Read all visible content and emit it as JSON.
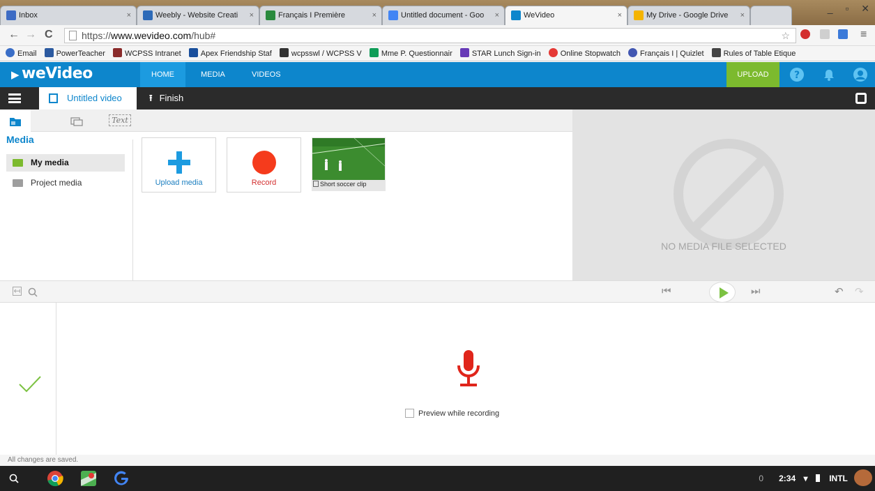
{
  "browser": {
    "tabs": [
      {
        "title": "Inbox",
        "icon": "mail-icon",
        "color": "#3d6bc4"
      },
      {
        "title": "Weebly - Website Creati",
        "icon": "weebly-icon",
        "color": "#2d6ab8"
      },
      {
        "title": "Français I Première",
        "icon": "classroom-icon",
        "color": "#2a8a3e"
      },
      {
        "title": "Untitled document - Goo",
        "icon": "docs-icon",
        "color": "#4285f4"
      },
      {
        "title": "WeVideo",
        "icon": "wevideo-icon",
        "color": "#0d86cc"
      },
      {
        "title": "My Drive - Google Drive",
        "icon": "drive-icon",
        "color": "#f4b400"
      }
    ],
    "active_tab": 4,
    "url_prefix": "https://",
    "url_domain": "www.wevideo.com",
    "url_path": "/hub#",
    "bookmarks": [
      {
        "label": "Email",
        "icon": "globe-icon",
        "color": "#3a6ec7"
      },
      {
        "label": "PowerTeacher",
        "icon": "powerteacher-icon",
        "color": "#2c5aa0"
      },
      {
        "label": "WCPSS Intranet",
        "icon": "wcpss-icon",
        "color": "#8a2b2b"
      },
      {
        "label": "Apex Friendship Staf",
        "icon": "apex-icon",
        "color": "#1a4f9c"
      },
      {
        "label": "wcpsswl / WCPSS V",
        "icon": "pb-icon",
        "color": "#333333"
      },
      {
        "label": "Mme P. Questionnair",
        "icon": "sheets-icon",
        "color": "#0f9d58"
      },
      {
        "label": "STAR Lunch Sign-in",
        "icon": "forms-icon",
        "color": "#673ab7"
      },
      {
        "label": "Online Stopwatch",
        "icon": "stopwatch-icon",
        "color": "#e53935"
      },
      {
        "label": "Français I | Quizlet",
        "icon": "quizlet-icon",
        "color": "#4257b2"
      },
      {
        "label": "Rules of Table Etique",
        "icon": "page-icon",
        "color": "#444444"
      }
    ]
  },
  "app": {
    "logo": "weVideo",
    "nav": [
      "HOME",
      "MEDIA",
      "VIDEOS"
    ],
    "active_nav": 0,
    "upload_label": "UPLOAD",
    "brand_color": "#0d86cc",
    "upload_color": "#7cba2e"
  },
  "editor": {
    "project_title": "Untitled video",
    "finish_label": "Finish"
  },
  "media_panel": {
    "tabs": [
      "media-tab",
      "transitions-tab",
      "text-tab"
    ],
    "text_tab_label": "Text",
    "title": "Media",
    "sidebar": [
      {
        "label": "My media",
        "active": true
      },
      {
        "label": "Project media",
        "active": false
      }
    ],
    "items": [
      {
        "label": "Upload media",
        "type": "upload"
      },
      {
        "label": "Record",
        "type": "record"
      },
      {
        "label": "Short soccer clip",
        "type": "video"
      }
    ],
    "preview_message": "NO MEDIA FILE SELECTED"
  },
  "recorder": {
    "preview_checkbox_label": "Preview while recording",
    "preview_checked": false,
    "status": "All changes are saved."
  },
  "shelf": {
    "notifications": "0",
    "time": "2:34",
    "keyboard": "INTL"
  }
}
